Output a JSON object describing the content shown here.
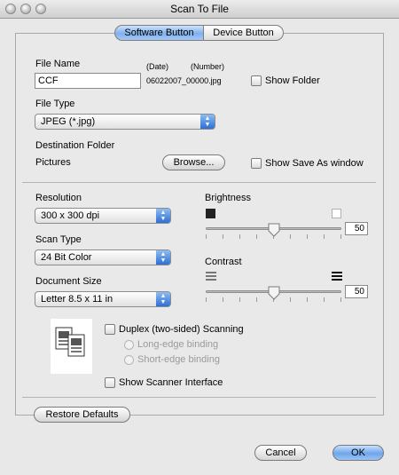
{
  "window": {
    "title": "Scan To File"
  },
  "tabs": [
    {
      "label": "Software Button"
    },
    {
      "label": "Device Button"
    }
  ],
  "file_name": {
    "label": "File Name",
    "value": "CCF",
    "date_caption": "(Date)",
    "number_caption": "(Number)",
    "sample": "06022007_00000.jpg",
    "show_folder": "Show Folder"
  },
  "file_type": {
    "label": "File Type",
    "value": "JPEG (*.jpg)"
  },
  "destination": {
    "label": "Destination Folder",
    "folder": "Pictures",
    "browse": "Browse...",
    "show_save_as": "Show Save As window"
  },
  "resolution": {
    "label": "Resolution",
    "value": "300 x 300 dpi"
  },
  "scan_type": {
    "label": "Scan Type",
    "value": "24 Bit Color"
  },
  "document_size": {
    "label": "Document Size",
    "value": "Letter  8.5 x 11 in"
  },
  "brightness": {
    "label": "Brightness",
    "value": "50",
    "level": 0.5
  },
  "contrast": {
    "label": "Contrast",
    "value": "50",
    "level": 0.5
  },
  "duplex": {
    "label": "Duplex (two-sided) Scanning",
    "long_edge": "Long-edge binding",
    "short_edge": "Short-edge binding"
  },
  "scanner_interface": {
    "label": "Show Scanner Interface"
  },
  "buttons": {
    "restore": "Restore Defaults",
    "cancel": "Cancel",
    "ok": "OK"
  }
}
